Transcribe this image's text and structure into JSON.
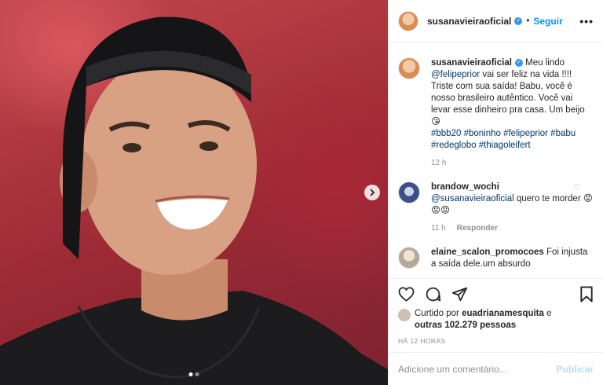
{
  "post": {
    "username": "susanavieiraoficial",
    "follow_label": "Seguir",
    "more_label": "•••",
    "dot": "•"
  },
  "caption": {
    "username": "susanavieiraoficial",
    "text1": " Meu lindo ",
    "mention": "@felipeprior",
    "text2": " vai ser feliz na vida !!!! Triste com sua saída! Babu, você é nosso brasileiro autêntico. Você vai levar esse dinheiro pra casa. Um beijo 😘",
    "hashtags": "#bbb20 #boninho #felipeprior #babu #redeglobo #thiagoleifert",
    "time": "12 h"
  },
  "comments": [
    {
      "username": "brandow_wochi",
      "mention": "@susanavieiraoficial",
      "text": " quero te morder 😡😡😡",
      "time": "11 h",
      "reply": "Responder"
    },
    {
      "username": "elaine_scalon_promocoes",
      "text": " Foi injusta a saída dele.um absurdo"
    }
  ],
  "likes": {
    "prefix": "Curtido por ",
    "user": "euadrianamesquita",
    "middle": " e ",
    "others": "outras 102.279 pessoas"
  },
  "posted_ago": "HÁ 12 HORAS",
  "add_comment": {
    "placeholder": "Adicione um comentário...",
    "publish_label": "Publicar"
  },
  "carousel": {
    "current": 1,
    "total": 2
  }
}
